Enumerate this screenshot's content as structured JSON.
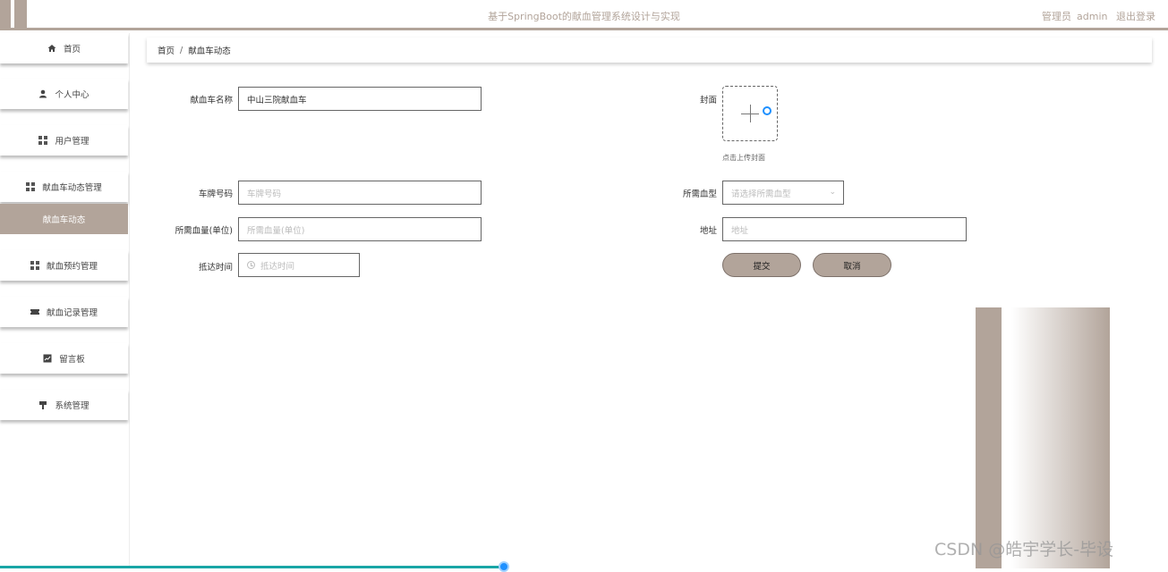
{
  "header": {
    "title": "基于SpringBoot的献血管理系统设计与实现",
    "user_role": "管理员",
    "username": "admin",
    "logout": "退出登录"
  },
  "sidebar": {
    "items": [
      {
        "label": "首页",
        "icon": "home-icon"
      },
      {
        "label": "个人中心",
        "icon": "user-icon"
      },
      {
        "label": "用户管理",
        "icon": "grid-icon"
      },
      {
        "label": "献血车动态管理",
        "icon": "grid-icon"
      },
      {
        "label": "献血预约管理",
        "icon": "grid-icon"
      },
      {
        "label": "献血记录管理",
        "icon": "ticket-icon"
      },
      {
        "label": "留言板",
        "icon": "chart-icon"
      },
      {
        "label": "系统管理",
        "icon": "pin-icon"
      }
    ],
    "active_sub": "献血车动态"
  },
  "breadcrumb": {
    "home": "首页",
    "separator": "/",
    "current": "献血车动态"
  },
  "form": {
    "name_label": "献血车名称",
    "name_value": "中山三院献血车",
    "cover_label": "封面",
    "cover_hint": "点击上传封面",
    "plate_label": "车牌号码",
    "plate_placeholder": "车牌号码",
    "blood_type_label": "所需血型",
    "blood_type_placeholder": "请选择所需血型",
    "volume_label": "所需血量(单位)",
    "volume_placeholder": "所需血量(单位)",
    "address_label": "地址",
    "address_placeholder": "地址",
    "arrival_label": "抵达时间",
    "arrival_placeholder": "抵达时间",
    "submit": "提交",
    "cancel": "取消"
  },
  "watermark": "CSDN @皓宇学长-毕设",
  "colors": {
    "accent": "#b2a49a",
    "border": "#666666"
  }
}
